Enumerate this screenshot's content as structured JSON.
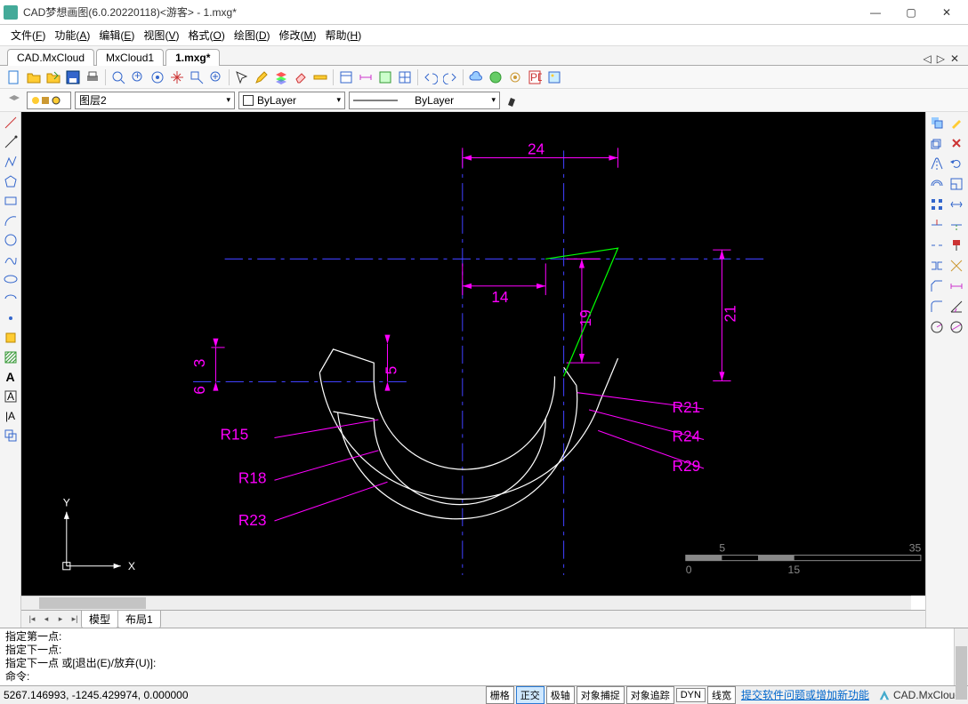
{
  "titlebar": {
    "title": "CAD梦想画图(6.0.20220118)<游客> - 1.mxg*"
  },
  "menu": {
    "items": [
      {
        "label": "文件",
        "key": "F"
      },
      {
        "label": "功能",
        "key": "A"
      },
      {
        "label": "编辑",
        "key": "E"
      },
      {
        "label": "视图",
        "key": "V"
      },
      {
        "label": "格式",
        "key": "O"
      },
      {
        "label": "绘图",
        "key": "D"
      },
      {
        "label": "修改",
        "key": "M"
      },
      {
        "label": "帮助",
        "key": "H"
      }
    ]
  },
  "doc_tabs": {
    "tabs": [
      {
        "label": "CAD.MxCloud",
        "active": false
      },
      {
        "label": "MxCloud1",
        "active": false
      },
      {
        "label": "1.mxg*",
        "active": true
      }
    ]
  },
  "layer_controls": {
    "layer_label": "图层2",
    "color_label": "ByLayer",
    "linetype_label": "ByLayer"
  },
  "drawing": {
    "dims": {
      "dim24": "24",
      "dim14": "14",
      "dim19": "19",
      "dim21": "21",
      "dim5": "5",
      "dim6": "6",
      "dim3": "3"
    },
    "radii": {
      "r15": "R15",
      "r18": "R18",
      "r23": "R23",
      "r21": "R21",
      "r24": "R24",
      "r29": "R29"
    },
    "axis": {
      "x": "X",
      "y": "Y"
    },
    "scale": {
      "v0": "0",
      "v5": "5",
      "v15": "15",
      "v35": "35"
    }
  },
  "model_tabs": {
    "items": [
      {
        "label": "模型",
        "active": true
      },
      {
        "label": "布局1",
        "active": false
      }
    ]
  },
  "command": {
    "history": [
      "指定第一点:",
      "指定下一点:",
      "指定下一点 或[退出(E)/放弃(U)]:"
    ],
    "prompt": "命令:"
  },
  "statusbar": {
    "coords": "5267.146993,  -1245.429974,  0.000000",
    "buttons": [
      {
        "label": "栅格",
        "active": false
      },
      {
        "label": "正交",
        "active": true
      },
      {
        "label": "极轴",
        "active": false
      },
      {
        "label": "对象捕捉",
        "active": false
      },
      {
        "label": "对象追踪",
        "active": false
      },
      {
        "label": "DYN",
        "active": false
      },
      {
        "label": "线宽",
        "active": false
      }
    ],
    "link": "提交软件问题或增加新功能",
    "brand": "CAD.MxCloud"
  }
}
